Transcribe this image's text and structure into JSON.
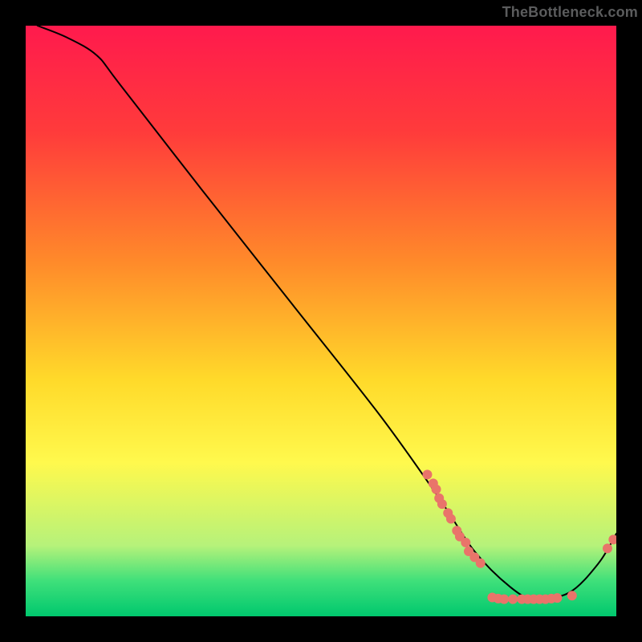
{
  "watermark": "TheBottleneck.com",
  "chart_data": {
    "type": "line",
    "title": "",
    "xlabel": "",
    "ylabel": "",
    "xlim": [
      0,
      100
    ],
    "ylim": [
      0,
      100
    ],
    "gradient": {
      "comment": "vertical background from red (top) through orange/yellow to green (bottom)",
      "stops": [
        {
          "offset": 0.0,
          "color": "#ff1a4d"
        },
        {
          "offset": 0.18,
          "color": "#ff3b3b"
        },
        {
          "offset": 0.4,
          "color": "#ff8a2a"
        },
        {
          "offset": 0.6,
          "color": "#ffda2a"
        },
        {
          "offset": 0.74,
          "color": "#fff94d"
        },
        {
          "offset": 0.88,
          "color": "#b6f27a"
        },
        {
          "offset": 0.94,
          "color": "#3fe07a"
        },
        {
          "offset": 1.0,
          "color": "#00c86e"
        }
      ]
    },
    "curve": {
      "comment": "the black descending curve hitting a minimum near x≈86 then rising",
      "points": [
        {
          "x": 2,
          "y": 100
        },
        {
          "x": 7,
          "y": 98
        },
        {
          "x": 12,
          "y": 95
        },
        {
          "x": 16,
          "y": 90
        },
        {
          "x": 30,
          "y": 72
        },
        {
          "x": 45,
          "y": 53
        },
        {
          "x": 60,
          "y": 34
        },
        {
          "x": 70,
          "y": 20
        },
        {
          "x": 76,
          "y": 11
        },
        {
          "x": 82,
          "y": 5
        },
        {
          "x": 86,
          "y": 3
        },
        {
          "x": 92,
          "y": 4
        },
        {
          "x": 97,
          "y": 9
        },
        {
          "x": 100,
          "y": 14
        }
      ]
    },
    "scatter": {
      "comment": "coral/pink dots clustered along lower-right portion of curve",
      "color": "#e9746a",
      "radius": 6,
      "points": [
        {
          "x": 68,
          "y": 24
        },
        {
          "x": 69,
          "y": 22.5
        },
        {
          "x": 69.5,
          "y": 21.5
        },
        {
          "x": 70,
          "y": 20
        },
        {
          "x": 70.5,
          "y": 19
        },
        {
          "x": 71.5,
          "y": 17.5
        },
        {
          "x": 72,
          "y": 16.5
        },
        {
          "x": 73,
          "y": 14.5
        },
        {
          "x": 73.5,
          "y": 13.5
        },
        {
          "x": 74.5,
          "y": 12.5
        },
        {
          "x": 75,
          "y": 11
        },
        {
          "x": 76,
          "y": 10
        },
        {
          "x": 77,
          "y": 9
        },
        {
          "x": 79,
          "y": 3.2
        },
        {
          "x": 80,
          "y": 3.0
        },
        {
          "x": 81,
          "y": 2.9
        },
        {
          "x": 82.5,
          "y": 2.9
        },
        {
          "x": 84,
          "y": 2.9
        },
        {
          "x": 85,
          "y": 2.9
        },
        {
          "x": 86,
          "y": 2.9
        },
        {
          "x": 87,
          "y": 2.9
        },
        {
          "x": 88,
          "y": 2.9
        },
        {
          "x": 89,
          "y": 3.0
        },
        {
          "x": 90,
          "y": 3.1
        },
        {
          "x": 92.5,
          "y": 3.5
        },
        {
          "x": 98.5,
          "y": 11.5
        },
        {
          "x": 99.5,
          "y": 13
        }
      ]
    }
  }
}
